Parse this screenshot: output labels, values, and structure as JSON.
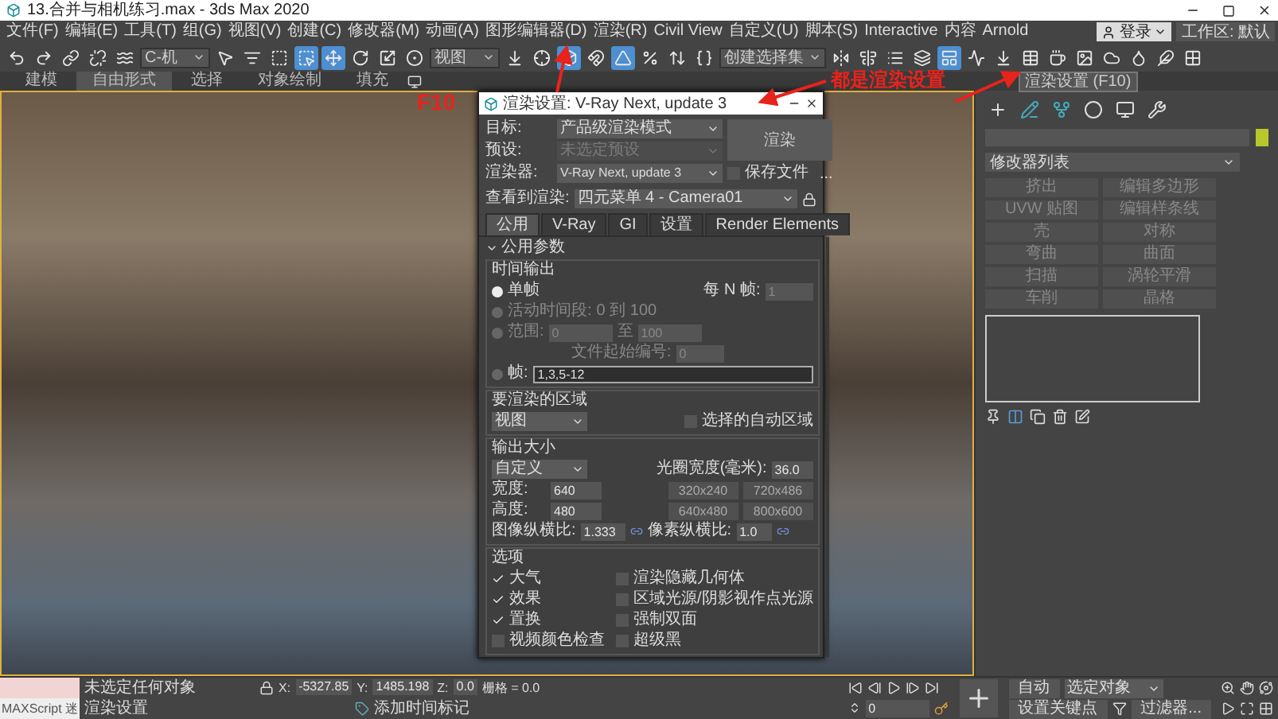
{
  "window": {
    "title": "13.合并与相机练习.max - 3ds Max 2020"
  },
  "menu": [
    "文件(F)",
    "编辑(E)",
    "工具(T)",
    "组(G)",
    "视图(V)",
    "创建(C)",
    "修改器(M)",
    "动画(A)",
    "图形编辑器(D)",
    "渲染(R)",
    "Civil View",
    "自定义(U)",
    "脚本(S)",
    "Interactive",
    "内容",
    "Arnold"
  ],
  "account": {
    "user": "登录",
    "workspace": "工作区: 默认"
  },
  "toolbar": [
    {
      "kind": "button",
      "selected": false
    },
    {
      "kind": "button",
      "selected": false
    },
    {
      "kind": "button",
      "selected": false
    },
    {
      "kind": "button",
      "selected": false
    },
    {
      "kind": "button",
      "selected": false
    },
    {
      "kind": "dropdown",
      "value": "C-机"
    },
    {
      "kind": "button",
      "selected": false
    },
    {
      "kind": "button",
      "selected": false
    },
    {
      "kind": "button",
      "selected": false
    },
    {
      "kind": "button",
      "selected": true
    },
    {
      "kind": "button",
      "selected": true
    },
    {
      "kind": "button",
      "selected": false
    },
    {
      "kind": "button",
      "selected": false
    },
    {
      "kind": "button",
      "selected": false
    },
    {
      "kind": "dropdown",
      "value": "视图"
    },
    {
      "kind": "button",
      "selected": false
    },
    {
      "kind": "button",
      "selected": false
    },
    {
      "kind": "button",
      "selected": true
    },
    {
      "kind": "button",
      "selected": false
    },
    {
      "kind": "button",
      "selected": true
    },
    {
      "kind": "button",
      "selected": false
    },
    {
      "kind": "button",
      "selected": false
    },
    {
      "kind": "button",
      "selected": false
    },
    {
      "kind": "dropdown",
      "value": "创建选择集"
    },
    {
      "kind": "button",
      "selected": false
    },
    {
      "kind": "button",
      "selected": false
    },
    {
      "kind": "button",
      "selected": false
    },
    {
      "kind": "button",
      "selected": false
    },
    {
      "kind": "button",
      "selected": true
    },
    {
      "kind": "button",
      "selected": false
    },
    {
      "kind": "button",
      "selected": false
    },
    {
      "kind": "button",
      "selected": false
    },
    {
      "kind": "button",
      "selected": false
    },
    {
      "kind": "button",
      "selected": false
    },
    {
      "kind": "button",
      "selected": false
    },
    {
      "kind": "button",
      "selected": false
    },
    {
      "kind": "button",
      "selected": false
    },
    {
      "kind": "button",
      "selected": false
    }
  ],
  "ribbon_tabs": [
    {
      "label": "建模",
      "selected": false
    },
    {
      "label": "自由形式",
      "selected": true
    },
    {
      "label": "选择",
      "selected": false
    },
    {
      "label": "对象绘制",
      "selected": false
    },
    {
      "label": "填充",
      "selected": false
    }
  ],
  "annotations": {
    "key_label": "F10",
    "note": "都是渲染设置"
  },
  "tooltip": "渲染设置 (F10)",
  "render_dialog": {
    "title": "渲染设置: V-Ray Next, update 3",
    "fields": [
      {
        "label": "目标:",
        "value": "产品级渲染模式",
        "disabled": false
      },
      {
        "label": "预设:",
        "value": "未选定预设",
        "disabled": true
      },
      {
        "label": "渲染器:",
        "value": "V-Ray Next, update 3",
        "disabled": false
      }
    ],
    "render_button": "渲染",
    "save_file": {
      "label": "保存文件",
      "checked": false
    },
    "more": "...",
    "view": {
      "label": "查看到渲染:",
      "value": "四元菜单 4 - Camera01"
    },
    "tabs": [
      {
        "label": "公用",
        "selected": true
      },
      {
        "label": "V-Ray",
        "selected": false
      },
      {
        "label": "GI",
        "selected": false
      },
      {
        "label": "设置",
        "selected": false
      },
      {
        "label": "Render Elements",
        "selected": false
      }
    ],
    "rollout": "公用参数",
    "time_output": {
      "title": "时间输出",
      "single": {
        "label": "单帧",
        "selected": true
      },
      "every_n": {
        "label": "每 N 帧:",
        "value": "1"
      },
      "active": {
        "label": "活动时间段:",
        "selected": false,
        "value": "0 到 100"
      },
      "range": {
        "label": "范围:",
        "selected": false,
        "from": "0",
        "to_label": "至",
        "to": "100"
      },
      "file_number": {
        "label": "文件起始编号:",
        "value": "0"
      },
      "frames": {
        "label": "帧:",
        "selected": false,
        "value": "1,3,5-12"
      }
    },
    "area": {
      "title": "要渲染的区域",
      "value": "视图",
      "auto": {
        "label": "选择的自动区域",
        "checked": false
      }
    },
    "output_size": {
      "title": "输出大小",
      "preset": "自定义",
      "aperture": {
        "label": "光圈宽度(毫米):",
        "value": "36.0"
      },
      "width": {
        "label": "宽度:",
        "value": "640"
      },
      "height": {
        "label": "高度:",
        "value": "480"
      },
      "presets": [
        "320x240",
        "720x486",
        "640x480",
        "800x600"
      ],
      "image_aspect": {
        "label": "图像纵横比:",
        "value": "1.333"
      },
      "pixel_aspect": {
        "label": "像素纵横比:",
        "value": "1.0"
      }
    },
    "options": {
      "title": "选项",
      "items": [
        {
          "label": "大气",
          "checked": true
        },
        {
          "label": "渲染隐藏几何体",
          "checked": false
        },
        {
          "label": "效果",
          "checked": true
        },
        {
          "label": "区域光源/阴影视作点光源",
          "checked": false
        },
        {
          "label": "置换",
          "checked": true
        },
        {
          "label": "强制双面",
          "checked": false
        },
        {
          "label": "视频颜色检查",
          "checked": false
        },
        {
          "label": "超级黑",
          "checked": false
        }
      ]
    }
  },
  "command_panel": {
    "modifier_list": "修改器列表",
    "buttons": [
      "挤出",
      "编辑多边形",
      "UVW 贴图",
      "编辑样条线",
      "壳",
      "对称",
      "弯曲",
      "曲面",
      "扫描",
      "涡轮平滑",
      "车削",
      "晶格"
    ]
  },
  "status": {
    "script": "MAXScript 迷",
    "selection": "未选定任何对象",
    "prompt": "渲染设置",
    "coords": [
      {
        "label": "X:",
        "value": "-5327.85"
      },
      {
        "label": "Y:",
        "value": "1485.198"
      },
      {
        "label": "Z:",
        "value": "0.0"
      }
    ],
    "grid": "栅格 = 0.0",
    "time_tag": "添加时间标记",
    "frame": "0",
    "auto_key": "自动",
    "key_filter": "选定对象",
    "set_key": "设置关键点",
    "filters": "过滤器..."
  }
}
